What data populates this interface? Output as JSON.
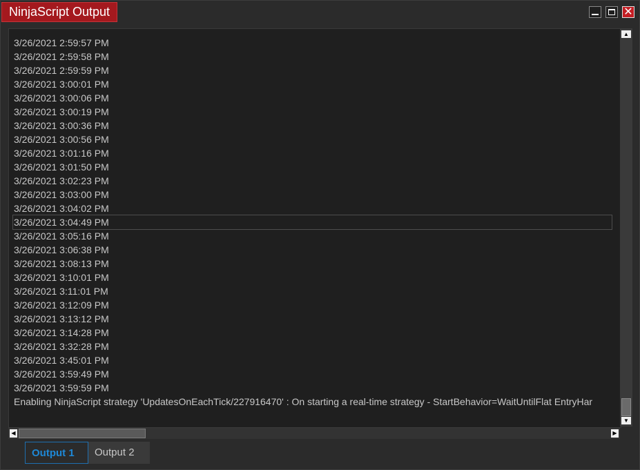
{
  "window": {
    "title": "NinjaScript Output",
    "controls": {
      "minimize": "minimize-icon",
      "maximize": "maximize-icon",
      "close": "close-icon"
    }
  },
  "output": {
    "lines": [
      "3/26/2021 2:59:57 PM",
      "3/26/2021 2:59:58 PM",
      "3/26/2021 2:59:59 PM",
      "3/26/2021 3:00:01 PM",
      "3/26/2021 3:00:06 PM",
      "3/26/2021 3:00:19 PM",
      "3/26/2021 3:00:36 PM",
      "3/26/2021 3:00:56 PM",
      "3/26/2021 3:01:16 PM",
      "3/26/2021 3:01:50 PM",
      "3/26/2021 3:02:23 PM",
      "3/26/2021 3:03:00 PM",
      "3/26/2021 3:04:02 PM",
      "3/26/2021 3:04:49 PM",
      "3/26/2021 3:05:16 PM",
      "3/26/2021 3:06:38 PM",
      "3/26/2021 3:08:13 PM",
      "3/26/2021 3:10:01 PM",
      "3/26/2021 3:11:01 PM",
      "3/26/2021 3:12:09 PM",
      "3/26/2021 3:13:12 PM",
      "3/26/2021 3:14:28 PM",
      "3/26/2021 3:32:28 PM",
      "3/26/2021 3:45:01 PM",
      "3/26/2021 3:59:49 PM",
      "3/26/2021 3:59:59 PM",
      "Enabling NinjaScript strategy 'UpdatesOnEachTick/227916470' : On starting a real-time strategy - StartBehavior=WaitUntilFlat EntryHar"
    ],
    "selected_index": 13
  },
  "tabs": [
    {
      "label": "Output 1",
      "active": true
    },
    {
      "label": "Output 2",
      "active": false
    }
  ],
  "colors": {
    "title_accent": "#a4191e",
    "active_tab": "#1e88d6",
    "text": "#c8c8c8",
    "background": "#1f1f1f"
  }
}
